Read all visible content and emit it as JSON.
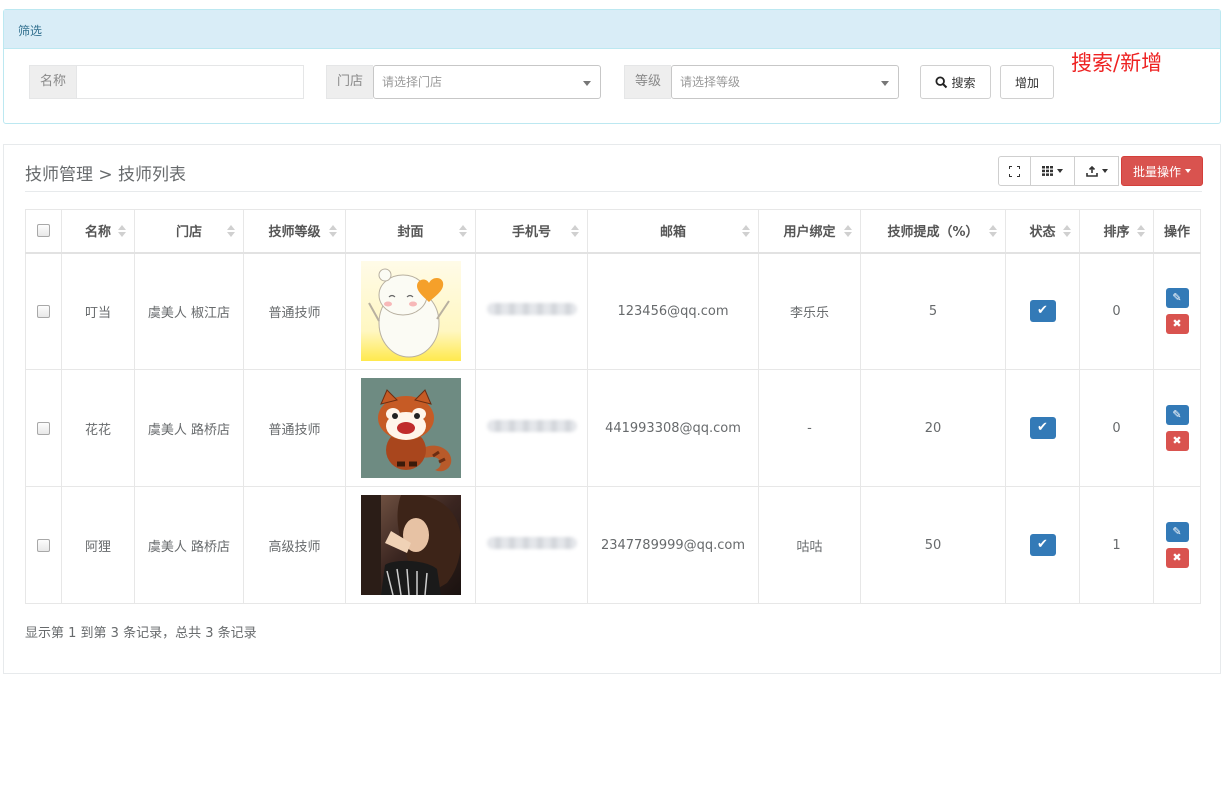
{
  "filter": {
    "title": "筛选",
    "name_label": "名称",
    "name_value": "",
    "store_label": "门店",
    "store_placeholder": "请选择门店",
    "level_label": "等级",
    "level_placeholder": "请选择等级",
    "search_label": "搜索",
    "add_label": "增加"
  },
  "annotation": "搜索/新增",
  "panel": {
    "breadcrumb": "技师管理 > 技师列表",
    "batch_label": "批量操作"
  },
  "table": {
    "columns": [
      "名称",
      "门店",
      "技师等级",
      "封面",
      "手机号",
      "邮箱",
      "用户绑定",
      "技师提成（%）",
      "状态",
      "排序",
      "操作"
    ],
    "rows": [
      {
        "name": "叮当",
        "store": "虞美人 椒江店",
        "level": "普通技师",
        "cover": "cartoon-bear-heart",
        "email": "123456@qq.com",
        "bind": "李乐乐",
        "commission": "5",
        "order": "0"
      },
      {
        "name": "花花",
        "store": "虞美人 路桥店",
        "level": "普通技师",
        "cover": "cartoon-red-panda",
        "email": "441993308@qq.com",
        "bind": "-",
        "commission": "20",
        "order": "0"
      },
      {
        "name": "阿狸",
        "store": "虞美人 路桥店",
        "level": "高级技师",
        "cover": "photo-woman",
        "email": "2347789999@qq.com",
        "bind": "咕咕",
        "commission": "50",
        "order": "1"
      }
    ]
  },
  "footer": {
    "info": "显示第 1 到第 3 条记录，总共 3 条记录"
  },
  "colors": {
    "info_bg": "#d9edf7",
    "primary": "#337ab7",
    "danger": "#d9534f",
    "annotation": "#ee2222"
  }
}
